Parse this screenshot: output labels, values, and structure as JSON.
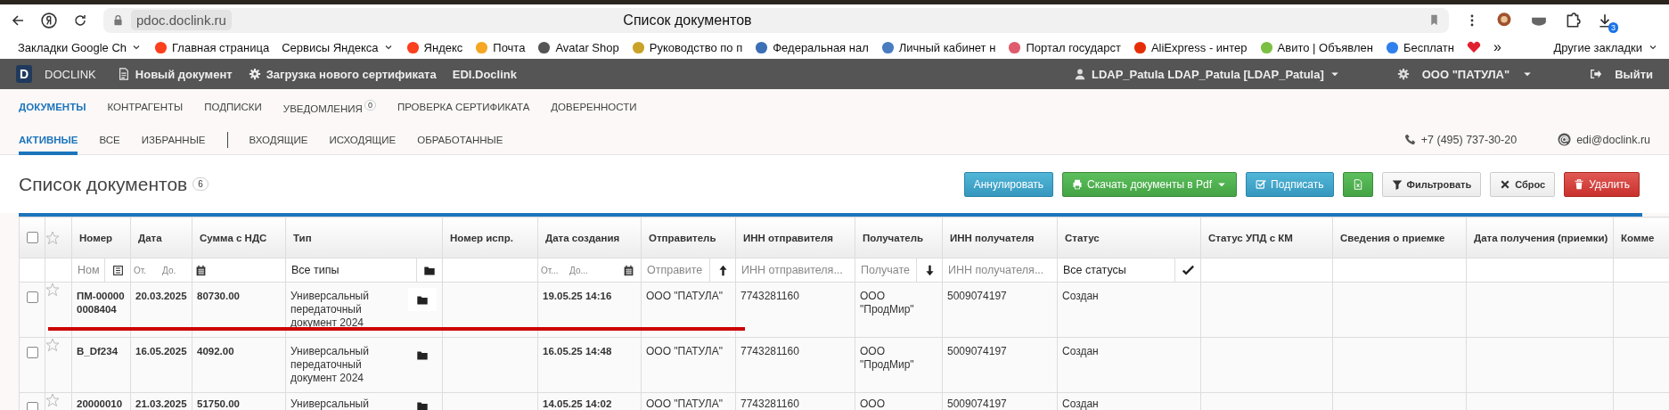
{
  "browser": {
    "url": "pdoc.doclink.ru",
    "title": "Список документов",
    "download_count": "3",
    "bookmarks": [
      {
        "kind": "folder",
        "label": "Закладки Google Ch"
      },
      {
        "kind": "site",
        "label": "Главная страница",
        "color": "#fc3f1d"
      },
      {
        "kind": "folder",
        "label": "Сервисы Яндекса"
      },
      {
        "kind": "site",
        "label": "Яндекс",
        "color": "#fc3f1d"
      },
      {
        "kind": "site",
        "label": "Почта",
        "color": "#f5a623"
      },
      {
        "kind": "site",
        "label": "Avatar Shop",
        "color": "#555555"
      },
      {
        "kind": "site",
        "label": "Руководство по п",
        "color": "#c9a227"
      },
      {
        "kind": "site",
        "label": "Федеральная нал",
        "color": "#3b6fb6"
      },
      {
        "kind": "site",
        "label": "Личный кабинет н",
        "color": "#4a7cc0"
      },
      {
        "kind": "site",
        "label": "Портал государст",
        "color": "#e05b6d"
      },
      {
        "kind": "site",
        "label": "AliExpress - интер",
        "color": "#e62e04"
      },
      {
        "kind": "site",
        "label": "Авито | Объявлен",
        "color": "#7bc043"
      },
      {
        "kind": "site",
        "label": "Бесплатн",
        "color": "#2f80ed"
      },
      {
        "kind": "icon",
        "color": "#e0202e"
      }
    ],
    "more": "»",
    "other_bookmarks": "Другие закладки"
  },
  "app_header": {
    "brand_letter": "D",
    "brand": "DOCLINK",
    "links": [
      "Новый документ",
      "Загрузка нового сертификата",
      "EDI.Doclink"
    ],
    "user": "LDAP_Patula LDAP_Patula [LDAP_Patula]",
    "org": "ООО \"ПАТУЛА\"",
    "logout": "Выйти"
  },
  "nav_tabs": [
    {
      "label": "ДОКУМЕНТЫ",
      "selected": true
    },
    {
      "label": "КОНТРАГЕНТЫ",
      "selected": false
    },
    {
      "label": "ПОДПИСКИ",
      "selected": false
    },
    {
      "label": "УВЕДОМЛЕНИЯ",
      "selected": false,
      "badge": "0"
    },
    {
      "label": "ПРОВЕРКА СЕРТИФИКАТА",
      "selected": false
    },
    {
      "label": "ДОВЕРЕННОСТИ",
      "selected": false
    }
  ],
  "sub_tab_groups": [
    {
      "tabs": [
        {
          "label": "АКТИВНЫЕ",
          "selected": true
        },
        {
          "label": "ВСЕ",
          "selected": false
        },
        {
          "label": "ИЗБРАННЫЕ",
          "selected": false
        }
      ]
    },
    {
      "tabs": [
        {
          "label": "ВХОДЯЩИЕ",
          "selected": false
        },
        {
          "label": "ИСХОДЯЩИЕ",
          "selected": false
        },
        {
          "label": "ОБРАБОТАННЫЕ",
          "selected": false
        }
      ]
    }
  ],
  "contacts": {
    "phone": "+7 (495) 737-30-20",
    "email": "edi@doclink.ru"
  },
  "list": {
    "title": "Список документов",
    "count": "6",
    "buttons": [
      {
        "kind": "info",
        "label": "Аннулировать"
      },
      {
        "kind": "success",
        "label": "Скачать документы в Pdf",
        "dropdown": true
      },
      {
        "kind": "info",
        "label": "Подписать"
      },
      {
        "kind": "success"
      },
      {
        "kind": "default",
        "label": "Фильтровать"
      },
      {
        "kind": "default",
        "label": "Сброс"
      },
      {
        "kind": "danger",
        "label": "Удалить"
      }
    ]
  },
  "table": {
    "select_all": {
      "checked": false
    },
    "columns": [
      {
        "label": "Номер"
      },
      {
        "label": "Дата"
      },
      {
        "label": "Сумма с НДС"
      },
      {
        "label": "Тип"
      },
      {
        "label": "Номер испр."
      },
      {
        "label": "Дата создания"
      },
      {
        "label": "Отправитель"
      },
      {
        "label": "ИНН отправителя"
      },
      {
        "label": "Получатель"
      },
      {
        "label": "ИНН получателя"
      },
      {
        "label": "Статус"
      },
      {
        "label": "Статус УПД с КМ"
      },
      {
        "label": "Сведения о приемке"
      },
      {
        "label": "Дата получения (приемки)"
      },
      {
        "label": "Комме"
      }
    ],
    "filters": [
      {
        "kind": "text-list",
        "placeholder": "Ном"
      },
      {
        "kind": "range",
        "from": {
          "placeholder": "От."
        },
        "to": {
          "placeholder": "До."
        }
      },
      {
        "kind": "none"
      },
      {
        "kind": "type-select",
        "value": "Все типы"
      },
      {
        "kind": "none"
      },
      {
        "kind": "range",
        "from": {
          "placeholder": "От..."
        },
        "to": {
          "placeholder": "До..."
        }
      },
      {
        "kind": "text-sort-asc",
        "placeholder": "Отправите"
      },
      {
        "kind": "text",
        "placeholder": "ИНН отправителя..."
      },
      {
        "kind": "text-sort-desc",
        "placeholder": "Получате"
      },
      {
        "kind": "text",
        "placeholder": "ИНН получателя..."
      },
      {
        "kind": "status-select",
        "value": "Все статусы"
      },
      {
        "kind": "none"
      },
      {
        "kind": "none"
      },
      {
        "kind": "none"
      },
      {
        "kind": "none"
      }
    ],
    "rows": [
      {
        "checked": false,
        "starred": false,
        "number": "ПМ-000000008404",
        "date": "20.03.2025",
        "sum": "80730.00",
        "type": "Универсальный передаточный документ 2024",
        "created": "19.05.25 14:16",
        "sender": "ООО \"ПАТУЛА\"",
        "sender_inn": "7743281160",
        "receiver": "ООО \"ПродМир\"",
        "receiver_inn": "5009074197",
        "status": "Создан"
      },
      {
        "checked": false,
        "starred": false,
        "number": "B_Df234",
        "date": "16.05.2025",
        "sum": "4092.00",
        "type": "Универсальный передаточный документ 2024",
        "created": "16.05.25 14:48",
        "sender": "ООО \"ПАТУЛА\"",
        "sender_inn": "7743281160",
        "receiver": "ООО \"ПродМир\"",
        "receiver_inn": "5009074197",
        "status": "Создан"
      },
      {
        "checked": false,
        "starred": false,
        "number": "20000010",
        "date": "21.03.2025",
        "sum": "51750.00",
        "type": "Универсальный",
        "created": "14.05.25 14:02",
        "sender": "ООО \"ПАТУЛА\"",
        "sender_inn": "7743281160",
        "receiver": "ООО",
        "receiver_inn": "5009074197",
        "status": "Создан"
      }
    ]
  }
}
